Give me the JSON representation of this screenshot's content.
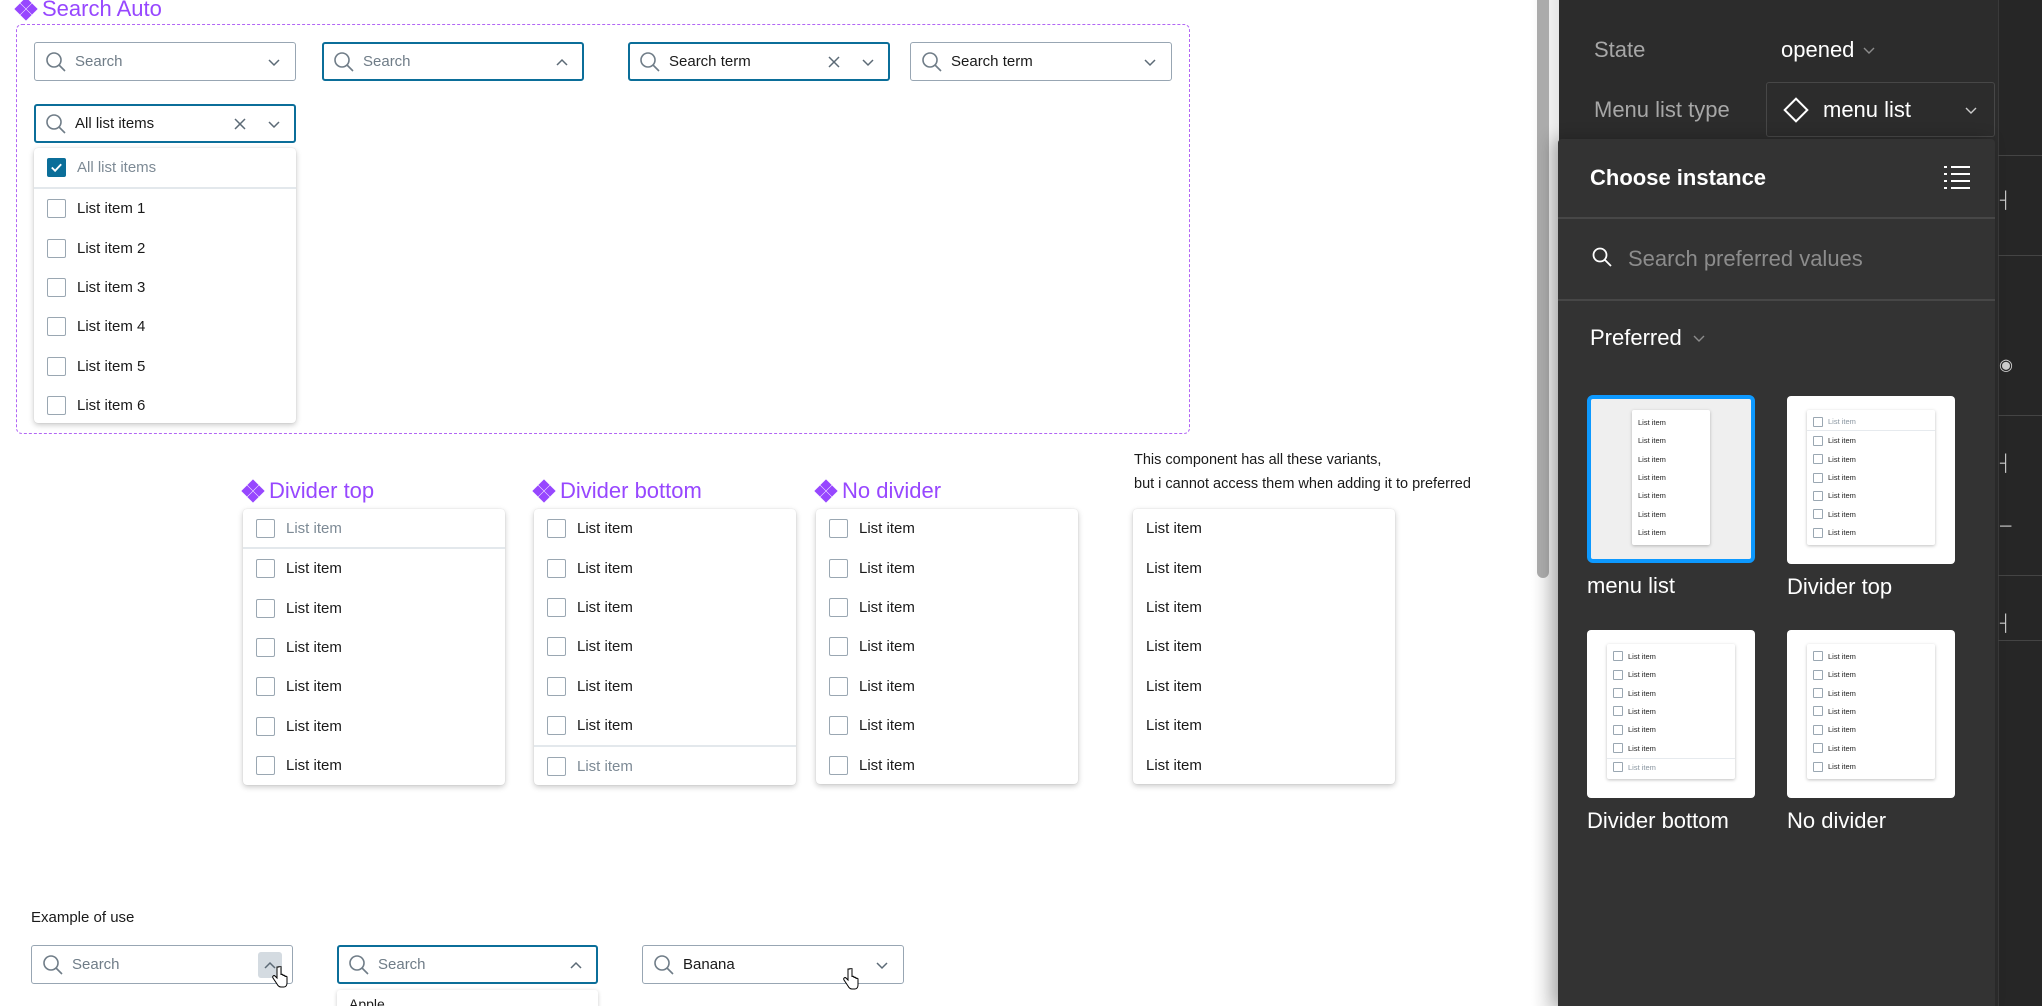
{
  "canvas": {
    "search_auto": {
      "title": "Search Auto",
      "fields": [
        {
          "placeholder": "Search",
          "value": "",
          "state": "default",
          "chevron": "down"
        },
        {
          "placeholder": "Search",
          "value": "",
          "state": "focused",
          "chevron": "up"
        },
        {
          "placeholder": "Search term",
          "value": "Search term",
          "state": "focused",
          "chevron": "down",
          "clearable": true
        },
        {
          "placeholder": "Search term",
          "value": "Search term",
          "state": "default",
          "chevron": "down"
        },
        {
          "placeholder": "All list items",
          "value": "All list items",
          "state": "focused",
          "chevron": "down",
          "clearable": true
        }
      ],
      "dropdown": {
        "select_all": {
          "label": "All list items",
          "checked": true
        },
        "items": [
          {
            "label": "List item 1",
            "checked": false
          },
          {
            "label": "List item 2",
            "checked": false
          },
          {
            "label": "List item 3",
            "checked": false
          },
          {
            "label": "List item 4",
            "checked": false
          },
          {
            "label": "List item 5",
            "checked": false
          },
          {
            "label": "List item 6",
            "checked": false
          }
        ]
      }
    },
    "variants": [
      {
        "title": "Divider top",
        "items": [
          "List item",
          "List item",
          "List item",
          "List item",
          "List item",
          "List item",
          "List item"
        ]
      },
      {
        "title": "Divider bottom",
        "items": [
          "List item",
          "List item",
          "List item",
          "List item",
          "List item",
          "List item",
          "List item"
        ]
      },
      {
        "title": "No divider",
        "items": [
          "List item",
          "List item",
          "List item",
          "List item",
          "List item",
          "List item",
          "List item"
        ]
      }
    ],
    "note": {
      "line1": "This component has all these variants,",
      "line2": "but i cannot access them when adding it to preferred"
    },
    "plain_menu": {
      "items": [
        "List item",
        "List item",
        "List item",
        "List item",
        "List item",
        "List item",
        "List item"
      ]
    },
    "example": {
      "label": "Example of use",
      "fields": [
        {
          "placeholder": "Search",
          "value": ""
        },
        {
          "placeholder": "Search",
          "value": ""
        },
        {
          "placeholder": "Search",
          "value": "Banana"
        }
      ],
      "partial_option": "Apple"
    }
  },
  "panel": {
    "state_label": "State",
    "state_value": "opened",
    "menu_list_type_label": "Menu list type",
    "menu_list_type_value": "menu list",
    "popover": {
      "title": "Choose instance",
      "search_placeholder": "Search preferred values",
      "section_label": "Preferred",
      "tiles": [
        {
          "label": "menu list",
          "selected": true
        },
        {
          "label": "Divider top",
          "selected": false
        },
        {
          "label": "Divider bottom",
          "selected": false
        },
        {
          "label": "No divider",
          "selected": false
        }
      ],
      "thumb_item_label": "List item"
    }
  },
  "colors": {
    "component_purple": "#9747ff",
    "focus_blue": "#0b6e99",
    "selection_blue": "#0d99ff",
    "panel_bg": "#2c2c2c",
    "popover_bg": "#333333"
  }
}
